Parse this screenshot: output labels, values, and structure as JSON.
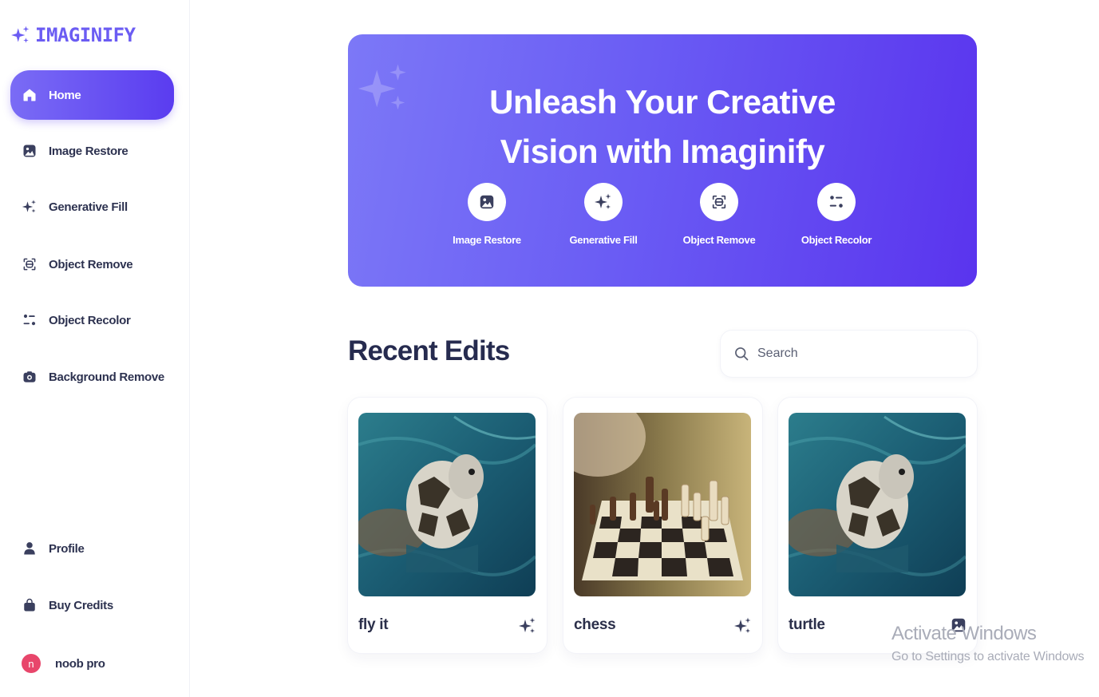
{
  "app": {
    "name": "IMAGINIFY"
  },
  "sidebar": {
    "items": [
      {
        "label": "Home",
        "icon": "home-icon",
        "active": true
      },
      {
        "label": "Image Restore",
        "icon": "image-icon"
      },
      {
        "label": "Generative Fill",
        "icon": "sparkles-icon"
      },
      {
        "label": "Object Remove",
        "icon": "scan-icon"
      },
      {
        "label": "Object Recolor",
        "icon": "filter-icon"
      },
      {
        "label": "Background Remove",
        "icon": "camera-icon"
      }
    ],
    "bottom": [
      {
        "label": "Profile",
        "icon": "profile-icon"
      },
      {
        "label": "Buy Credits",
        "icon": "bag-icon"
      }
    ],
    "user": {
      "name": "noob pro",
      "initial": "n"
    }
  },
  "hero": {
    "title_line1": "Unleash Your Creative",
    "title_line2": "Vision with Imaginify",
    "tools": [
      {
        "label": "Image Restore",
        "icon": "image-icon"
      },
      {
        "label": "Generative Fill",
        "icon": "sparkles-icon"
      },
      {
        "label": "Object Remove",
        "icon": "scan-icon"
      },
      {
        "label": "Object Recolor",
        "icon": "filter-icon"
      }
    ]
  },
  "recent": {
    "title": "Recent Edits",
    "search_placeholder": "Search",
    "cards": [
      {
        "title": "fly it",
        "image": "sea turtle in water",
        "icon": "sparkles-icon"
      },
      {
        "title": "chess",
        "image": "chessboard with pieces",
        "icon": "sparkles-icon"
      },
      {
        "title": "turtle",
        "image": "sea turtle in water",
        "icon": "image-icon"
      }
    ]
  },
  "watermark": {
    "line1": "Activate Windows",
    "line2": "Go to Settings to activate Windows"
  },
  "colors": {
    "accent": "#6b5cf3",
    "accent_dark": "#5a34ee",
    "text": "#2b2f4a",
    "avatar": "#e8466b"
  }
}
